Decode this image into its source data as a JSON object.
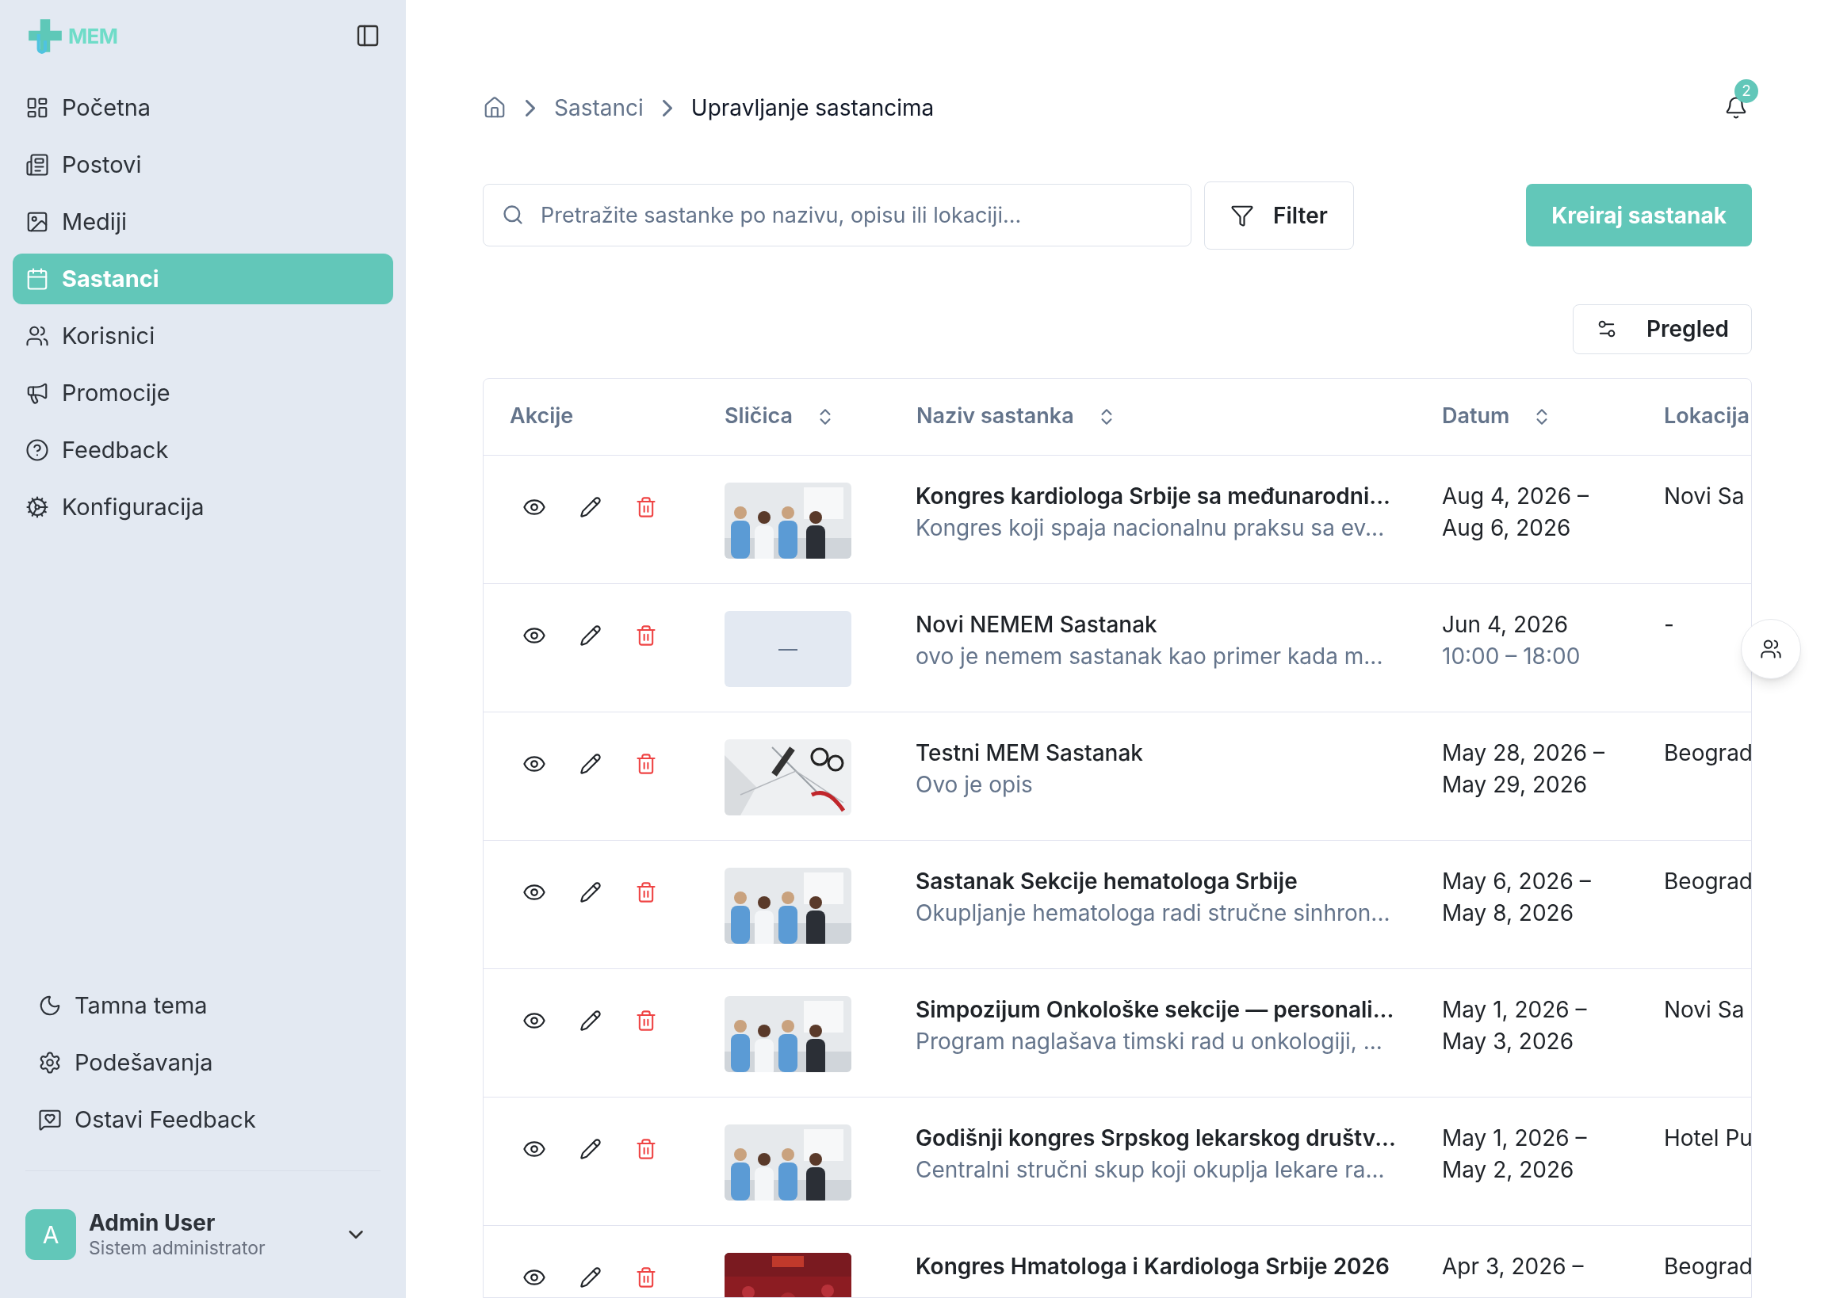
{
  "sidebar": {
    "logo": "MEM",
    "items": [
      {
        "label": "Početna",
        "selected": false
      },
      {
        "label": "Postovi",
        "selected": false
      },
      {
        "label": "Mediji",
        "selected": false
      },
      {
        "label": "Sastanci",
        "selected": true
      },
      {
        "label": "Korisnici",
        "selected": false
      },
      {
        "label": "Promocije",
        "selected": false
      },
      {
        "label": "Feedback",
        "selected": false
      },
      {
        "label": "Konfiguracija",
        "selected": false
      }
    ],
    "footer_items": [
      {
        "label": "Tamna tema"
      },
      {
        "label": "Podešavanja"
      },
      {
        "label": "Ostavi Feedback"
      }
    ],
    "user": {
      "initial": "A",
      "name": "Admin User",
      "role": "Sistem administrator"
    }
  },
  "breadcrumb": [
    "Sastanci",
    "Upravljanje sastancima"
  ],
  "notifications": {
    "count": "2"
  },
  "search": {
    "placeholder": "Pretražite sastanke po nazivu, opisu ili lokaciji..."
  },
  "filter_button": "Filter",
  "create_button": "Kreiraj sastanak",
  "view_button": "Pregled",
  "table": {
    "columns": [
      {
        "label": "Akcije",
        "sortable": false
      },
      {
        "label": "Sličica",
        "sortable": true
      },
      {
        "label": "Naziv sastanka",
        "sortable": true
      },
      {
        "label": "Datum",
        "sortable": true
      },
      {
        "label": "Lokacija"
      }
    ],
    "rows": [
      {
        "title": "Kongres kardiologa Srbije sa međunarodni...",
        "description": "Kongres koji spaja nacionalnu praksu sa ev...",
        "start": "Aug 4, 2026 –",
        "end": "Aug 6, 2026",
        "location": "Novi Sa"
      },
      {
        "thumbnail": {
          "kind": "empty",
          "text": "—"
        },
        "title": "Novi NEMEM Sastanak",
        "description": "ovo je nemem sastanak kao primer kada m...",
        "start": "Jun 4, 2026",
        "time": "10:00 – 18:00",
        "location": "-"
      },
      {
        "title": "Testni MEM Sastanak",
        "description": "Ovo je opis",
        "start": "May 28, 2026 –",
        "end": "May 29, 2026",
        "location": "Beograd"
      },
      {
        "title": "Sastanak Sekcije hematologa Srbije",
        "description": "Okupljanje hematologa radi stručne sinhron...",
        "start": "May 6, 2026 –",
        "end": "May 8, 2026",
        "location": "Beograd"
      },
      {
        "title": "Simpozijum Onkološke sekcije — personali...",
        "description": "Program naglašava timski rad u onkologiji, ...",
        "start": "May 1, 2026 –",
        "end": "May 3, 2026",
        "location": "Novi Sa"
      },
      {
        "title": "Godišnji kongres Srpskog lekarskog društv...",
        "description": "Centralni stručni skup koji okuplja lekare ra...",
        "start": "May 1, 2026 –",
        "end": "May 2, 2026",
        "location": "Hotel Pu"
      },
      {
        "title": "Kongres Hmatologa i Kardiologa Srbije 2026",
        "start": "Apr 3, 2026 –",
        "location": "Beograd"
      }
    ]
  }
}
